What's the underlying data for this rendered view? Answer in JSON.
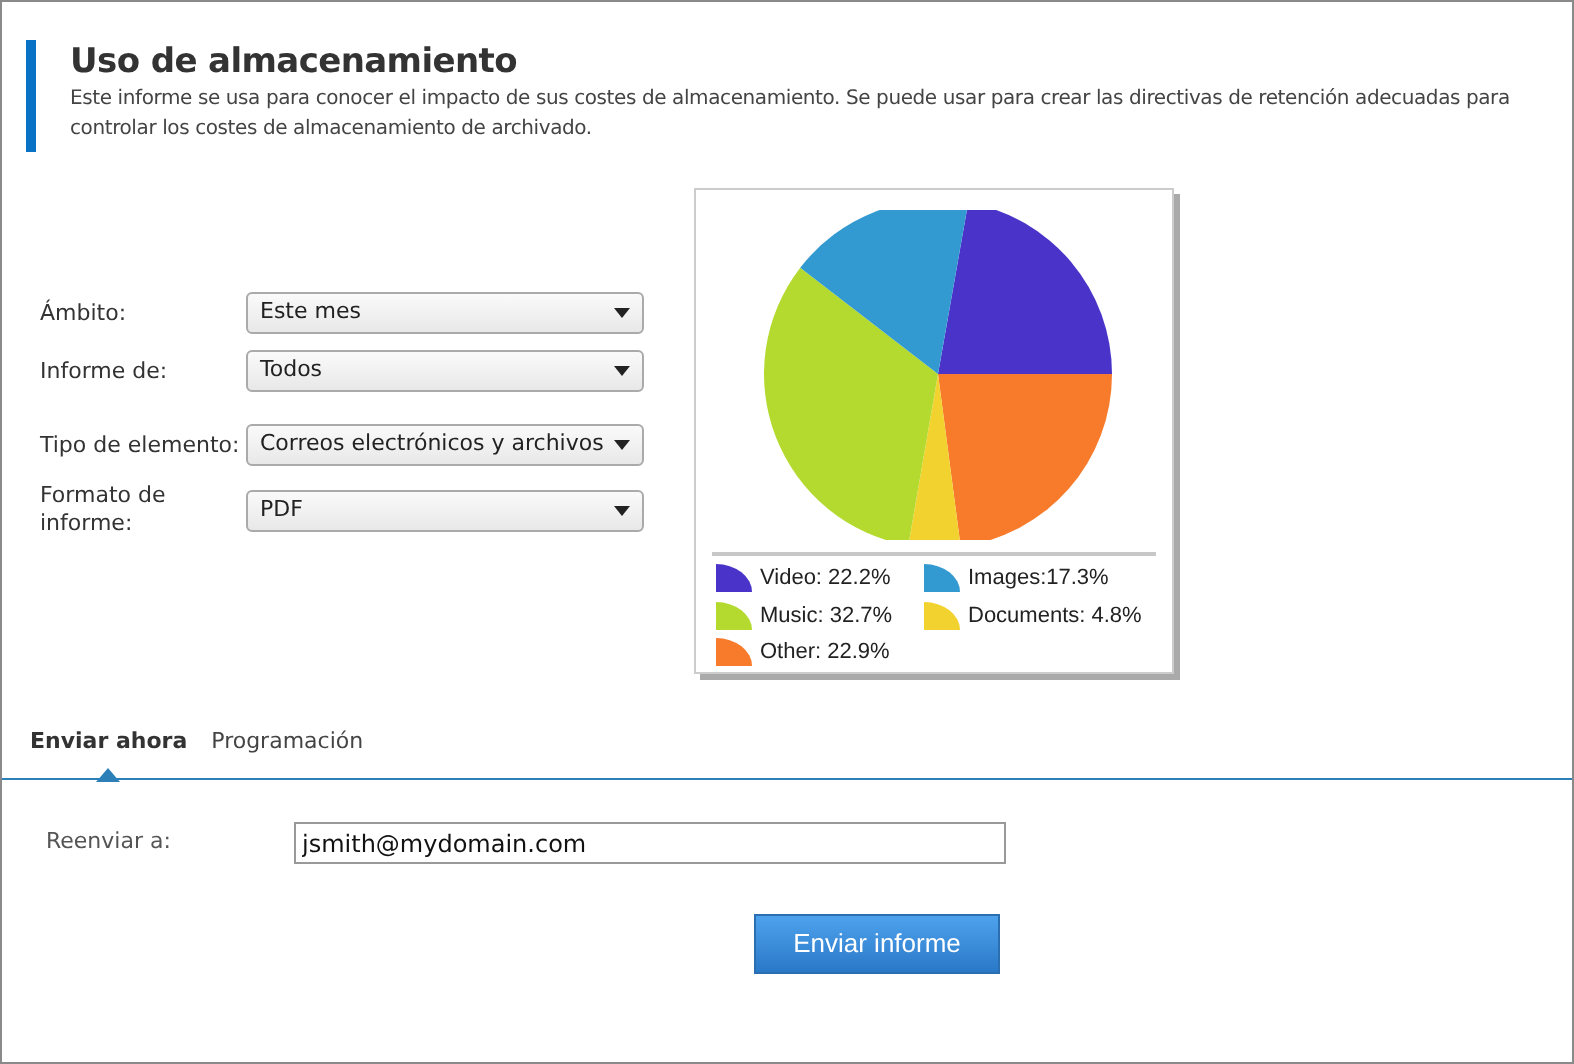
{
  "header": {
    "title": "Uso de almacenamiento",
    "description": "Este informe se usa para conocer el impacto de sus costes de almacenamiento. Se puede usar para crear las directivas de retención adecuadas para controlar los costes de almacenamiento de archivado."
  },
  "form": [
    {
      "label": "Ámbito:",
      "value": "Este mes"
    },
    {
      "label": "Informe de:",
      "value": "Todos"
    },
    {
      "label": "Tipo de elemento:",
      "value": "Correos electrónicos y archivos"
    },
    {
      "label": "Formato de informe:",
      "value": "PDF"
    }
  ],
  "chart": {
    "chart_data": {
      "type": "pie",
      "values": [
        22.2,
        22.9,
        4.8,
        32.7,
        17.3
      ],
      "colors": [
        "#4a33c9",
        "#f77b2b",
        "#f2d22e",
        "#b4da2f",
        "#3399d1"
      ]
    },
    "legend": [
      {
        "label": "Video: 22.2%",
        "color": "#4a33c9"
      },
      {
        "label": "Images:17.3%",
        "color": "#3399d1"
      },
      {
        "label": "Music: 32.7%",
        "color": "#b4da2f"
      },
      {
        "label": "Documents: 4.8%",
        "color": "#f2d22e"
      },
      {
        "label": "Other: 22.9%",
        "color": "#f77b2b"
      }
    ]
  },
  "tabs": [
    {
      "label": "Enviar ahora",
      "selected": true
    },
    {
      "label": "Programación",
      "selected": false
    }
  ],
  "forward": {
    "label": "Reenviar a:",
    "value": "jsmith@mydomain.com"
  },
  "submit": "Enviar informe"
}
